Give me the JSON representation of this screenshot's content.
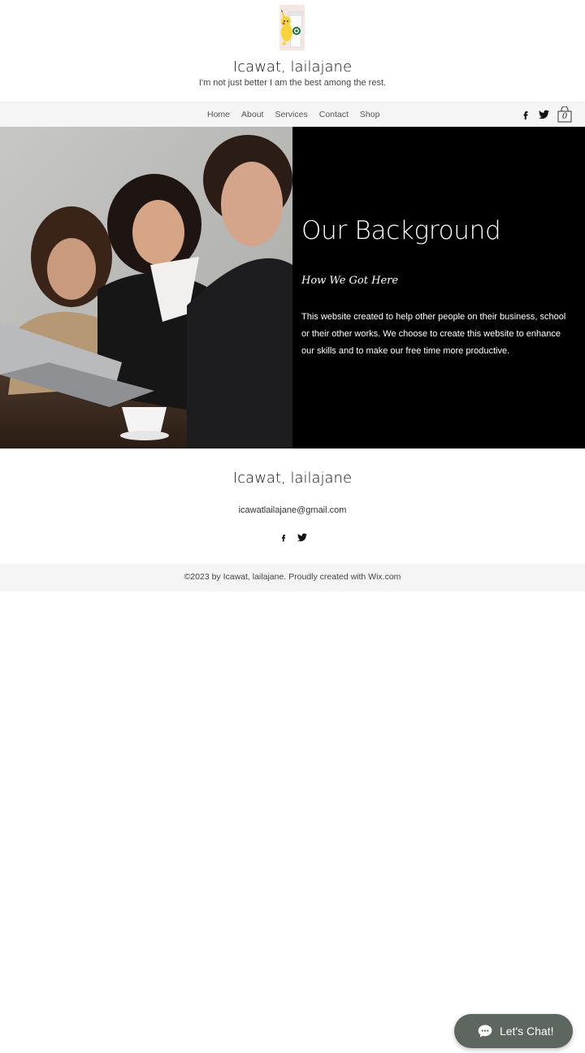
{
  "header": {
    "logo_icon": "pikachu-starbucks-cup-icon",
    "site_title": "Icawat, lailajane",
    "tagline": "I'm not just better I am the best among the rest."
  },
  "nav": {
    "items": [
      {
        "label": "Home"
      },
      {
        "label": "About"
      },
      {
        "label": "Services"
      },
      {
        "label": "Contact"
      },
      {
        "label": "Shop"
      }
    ],
    "social_icons": [
      "facebook-icon",
      "twitter-icon"
    ],
    "cart": {
      "icon": "shopping-bag-icon",
      "count": "0"
    }
  },
  "hero": {
    "photo_icon": "office-team-laptop-photo",
    "heading": "Our Background",
    "subheading": "How We Got Here",
    "body": "This website created to help other people on their business, school or their other works. We choose to create this website to enhance our skills and to make our free time more productive."
  },
  "footer": {
    "title": "Icawat, lailajane",
    "email": "icawatlailajane@gmail.com",
    "social_icons": [
      "facebook-icon",
      "twitter-icon"
    ],
    "copyright": "©2023 by Icawat, lailajane. Proudly created with Wix.com"
  },
  "chat": {
    "icon": "chat-bubble-icon",
    "label": "Let's Chat!"
  },
  "colors": {
    "nav_bg": "#f5f5f5",
    "hero_panel_bg": "#000000",
    "chat_bg": "#5d6760"
  }
}
